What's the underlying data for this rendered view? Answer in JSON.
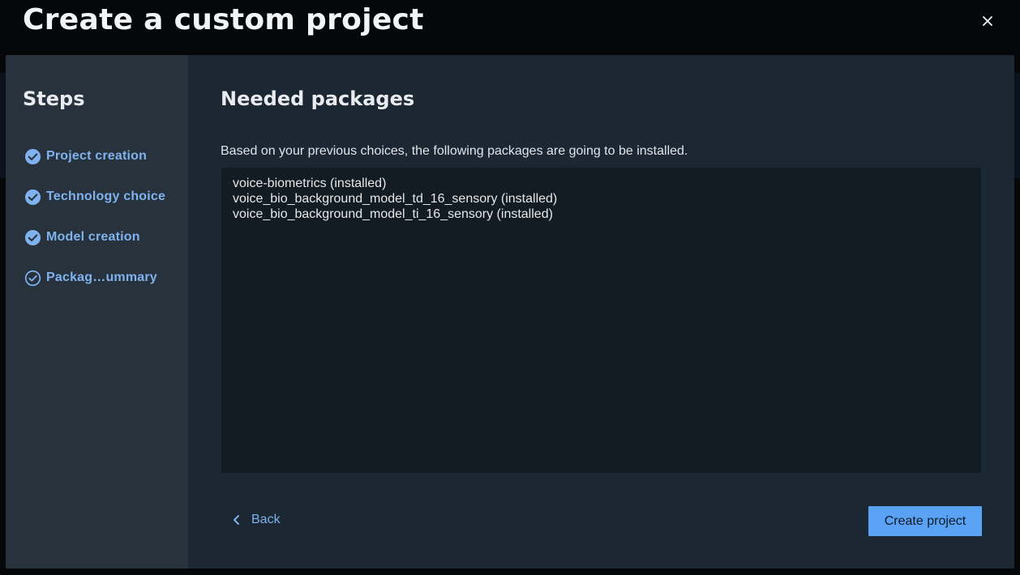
{
  "dialog": {
    "title": "Create a custom project",
    "close_icon": "close-icon"
  },
  "sidebar": {
    "title": "Steps",
    "steps": [
      {
        "label": "Project creation",
        "status": "completed",
        "icon": "check-circle-filled-icon"
      },
      {
        "label": "Technology choice",
        "status": "completed",
        "icon": "check-circle-filled-icon"
      },
      {
        "label": "Model creation",
        "status": "completed",
        "icon": "check-circle-filled-icon"
      },
      {
        "label": "Packag…ummary",
        "status": "current",
        "icon": "check-circle-outline-icon"
      }
    ]
  },
  "main": {
    "title": "Needed packages",
    "description": "Based on your previous choices, the following packages are going to be installed.",
    "packages": [
      "voice-biometrics (installed)",
      "voice_bio_background_model_td_16_sensory (installed)",
      "voice_bio_background_model_ti_16_sensory (installed)"
    ]
  },
  "footer": {
    "back_label": "Back",
    "back_icon": "chevron-left-icon",
    "create_label": "Create project"
  },
  "colors": {
    "accent": "#5aa2f4",
    "step_text": "#7fb2ee",
    "sidebar_bg": "#27323d",
    "main_bg": "#1b2733",
    "box_bg": "#131b23"
  }
}
